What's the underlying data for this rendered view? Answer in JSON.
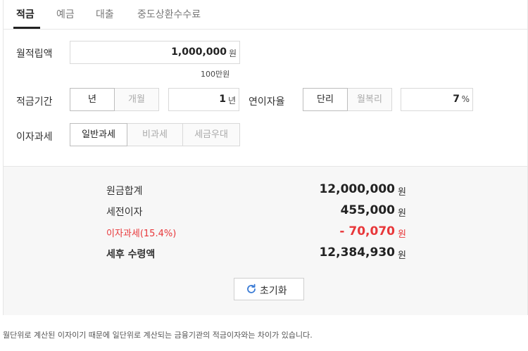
{
  "tabs": [
    {
      "label": "적금"
    },
    {
      "label": "예금"
    },
    {
      "label": "대출"
    },
    {
      "label": "중도상환수수료"
    }
  ],
  "monthly_deposit": {
    "label": "월적립액",
    "value": "1,000,000",
    "unit": "원",
    "hint": "100만원"
  },
  "period": {
    "label": "적금기간",
    "unit_options": [
      "년",
      "개월"
    ],
    "value": "1",
    "unit": "년"
  },
  "interest_rate": {
    "label": "연이자율",
    "type_options": [
      "단리",
      "월복리"
    ],
    "value": "7",
    "unit": "%"
  },
  "tax": {
    "label": "이자과세",
    "options": [
      "일반과세",
      "비과세",
      "세금우대"
    ]
  },
  "result": {
    "rows": [
      {
        "label": "원금합계",
        "value": "12,000,000",
        "unit": "원"
      },
      {
        "label": "세전이자",
        "value": "455,000",
        "unit": "원"
      },
      {
        "label": "이자과세(15.4%)",
        "value": "- 70,070",
        "unit": "원"
      },
      {
        "label": "세후 수령액",
        "value": "12,384,930",
        "unit": "원"
      }
    ],
    "reset_label": "초기화"
  },
  "note": "월단위로 계산된 이자이기 때문에 일단위로 계산되는 금융기관의 적금이자와는 차이가 있습니다.",
  "colors": {
    "accent_red": "#e8373a",
    "refresh_icon": "#3a7bd5"
  },
  "icons": {
    "reset": "refresh-icon"
  }
}
